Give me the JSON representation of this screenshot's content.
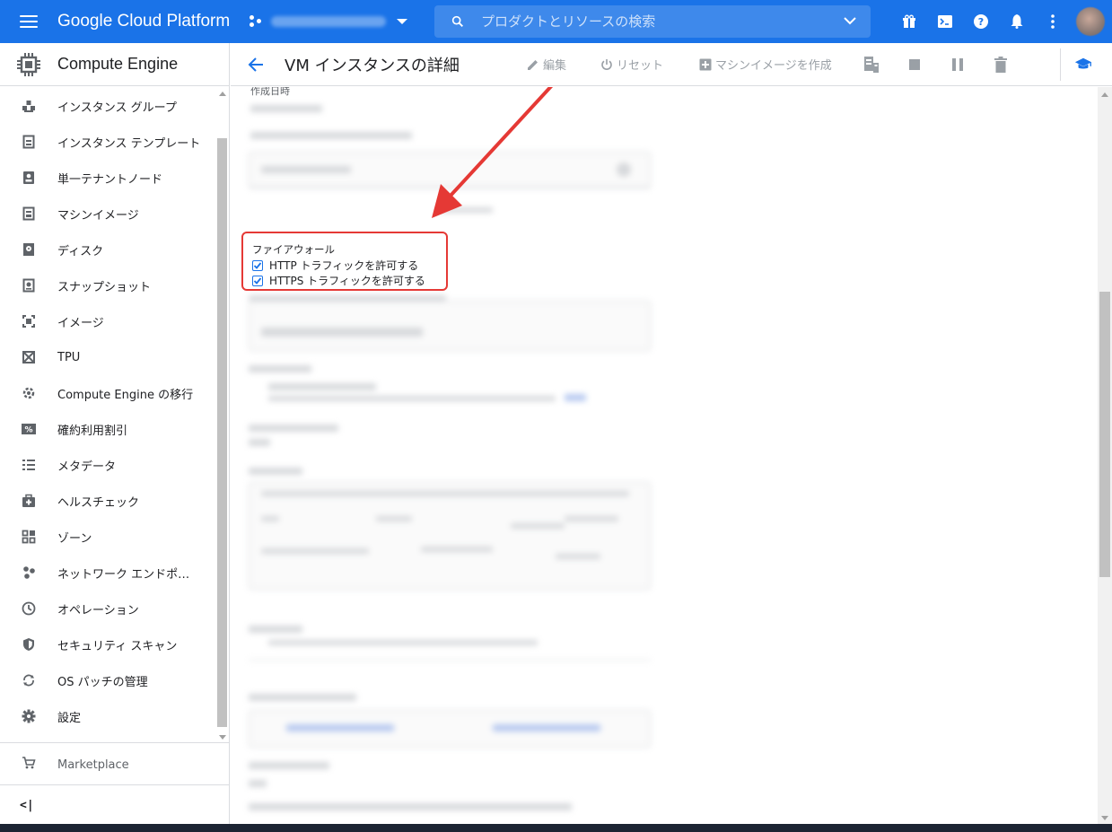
{
  "topbar": {
    "brand": "Google Cloud Platform",
    "search_placeholder": "プロダクトとリソースの検索",
    "icons": [
      "gift-icon",
      "cloud-shell-icon",
      "help-icon",
      "notifications-icon",
      "more-vert-icon"
    ]
  },
  "sidenav": {
    "header_title": "Compute Engine",
    "items": [
      {
        "label": "インスタンス グループ",
        "icon": "instance-groups-icon"
      },
      {
        "label": "インスタンス テンプレート",
        "icon": "instance-templates-icon"
      },
      {
        "label": "単一テナントノード",
        "icon": "sole-tenant-nodes-icon"
      },
      {
        "label": "マシンイメージ",
        "icon": "machine-images-icon"
      },
      {
        "label": "ディスク",
        "icon": "disks-icon"
      },
      {
        "label": "スナップショット",
        "icon": "snapshots-icon"
      },
      {
        "label": "イメージ",
        "icon": "images-icon"
      },
      {
        "label": "TPU",
        "icon": "tpu-icon"
      },
      {
        "label": "Compute Engine の移行",
        "icon": "migrate-icon"
      },
      {
        "label": "確約利用割引",
        "icon": "committed-use-discounts-icon"
      },
      {
        "label": "メタデータ",
        "icon": "metadata-icon"
      },
      {
        "label": "ヘルスチェック",
        "icon": "health-checks-icon"
      },
      {
        "label": "ゾーン",
        "icon": "zones-icon"
      },
      {
        "label": "ネットワーク エンドポイント グループ",
        "icon": "network-endpoint-groups-icon"
      },
      {
        "label": "オペレーション",
        "icon": "operations-icon"
      },
      {
        "label": "セキュリティ スキャン",
        "icon": "security-scans-icon"
      },
      {
        "label": "OS パッチの管理",
        "icon": "os-patch-icon"
      },
      {
        "label": "設定",
        "icon": "settings-icon"
      }
    ],
    "marketplace": "Marketplace",
    "collapse": "<|"
  },
  "toolbar": {
    "title": "VM インスタンスの詳細",
    "edit": "編集",
    "reset": "リセット",
    "create_machine_image": "マシンイメージを作成"
  },
  "content": {
    "created_label": "作成日時",
    "firewall": {
      "title": "ファイアウォール",
      "options": [
        {
          "label": "HTTP トラフィックを許可する",
          "checked": true
        },
        {
          "label": "HTTPS トラフィックを許可する",
          "checked": true
        }
      ]
    }
  },
  "colors": {
    "primary": "#1a73e8",
    "highlight": "#e53935"
  }
}
